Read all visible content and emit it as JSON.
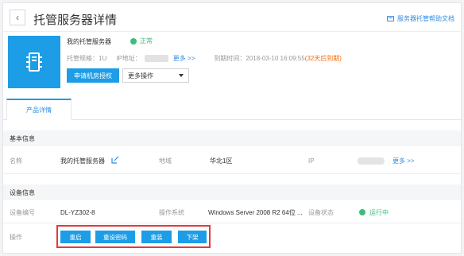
{
  "header": {
    "back_icon": "chevron-left-icon",
    "title": "托管服务器详情",
    "help_link": "服务器托管帮助文档",
    "help_icon": "folder-icon"
  },
  "summary": {
    "server_name": "我的托管服务器",
    "status": "正常",
    "spec_label": "托管规格：1U",
    "ip_label": "IP地址：",
    "more": "更多 >>",
    "expire_label": "到期时间：2018-03-10 16:09:55",
    "expire_note": "(32天后到期)",
    "apply_button": "申请机房授权",
    "more_actions": "更多操作",
    "icon": "server-icon"
  },
  "tabs": [
    {
      "label": "产品详情",
      "active": true
    }
  ],
  "basic_info": {
    "heading": "基本信息",
    "name_label": "名称",
    "name_value": "我的托管服务器",
    "region_label": "地域",
    "region_value": "华北1区",
    "ip_label": "IP",
    "more": "更多 >>"
  },
  "device_info": {
    "heading": "设备信息",
    "device_no_label": "设备编号",
    "device_no_value": "DL-YZ302-8",
    "os_label": "操作系统",
    "os_value": "Windows Server 2008 R2 64位 ...",
    "device_status_label": "设备状态",
    "device_status_value": "运行中",
    "ops_label": "操作",
    "ops": [
      "重启",
      "重设密码",
      "重装",
      "下架"
    ]
  },
  "colors": {
    "accent": "#1d9de6",
    "status_green": "#3dbd7d",
    "link_blue": "#2f8de4",
    "highlight_red": "#e53935",
    "expire_orange": "#ff6a00"
  }
}
